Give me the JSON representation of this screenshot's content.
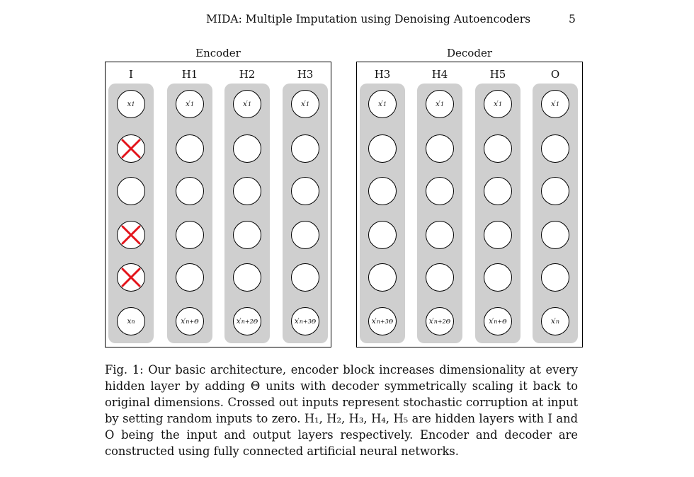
{
  "header": {
    "running_title": "MIDA: Multiple Imputation using Denoising Autoencoders",
    "page_number": "5"
  },
  "figure": {
    "blocks": [
      {
        "title": "Encoder",
        "columns": [
          {
            "label": "I",
            "nodes": [
              {
                "base": "x",
                "sub": "1",
                "prime": ""
              },
              {
                "crossed": true
              },
              {
                "base": ""
              },
              {
                "crossed": true
              },
              {
                "crossed": true
              },
              {
                "base": "x",
                "sub": "n",
                "prime": ""
              }
            ]
          },
          {
            "label": "H1",
            "nodes": [
              {
                "base": "x",
                "sub": "1",
                "prime": "′"
              },
              {
                "base": ""
              },
              {
                "base": ""
              },
              {
                "base": ""
              },
              {
                "base": ""
              },
              {
                "base": "x",
                "sub": "n+Θ",
                "prime": "′"
              }
            ]
          },
          {
            "label": "H2",
            "nodes": [
              {
                "base": "x",
                "sub": "1",
                "prime": "′"
              },
              {
                "base": ""
              },
              {
                "base": ""
              },
              {
                "base": ""
              },
              {
                "base": ""
              },
              {
                "base": "x",
                "sub": "n+2Θ",
                "prime": "′"
              }
            ]
          },
          {
            "label": "H3",
            "nodes": [
              {
                "base": "x",
                "sub": "1",
                "prime": "′"
              },
              {
                "base": ""
              },
              {
                "base": ""
              },
              {
                "base": ""
              },
              {
                "base": ""
              },
              {
                "base": "x",
                "sub": "n+3Θ",
                "prime": "′"
              }
            ]
          }
        ]
      },
      {
        "title": "Decoder",
        "columns": [
          {
            "label": "H3",
            "nodes": [
              {
                "base": "x",
                "sub": "1",
                "prime": "′"
              },
              {
                "base": ""
              },
              {
                "base": ""
              },
              {
                "base": ""
              },
              {
                "base": ""
              },
              {
                "base": "x",
                "sub": "n+3Θ",
                "prime": "′"
              }
            ]
          },
          {
            "label": "H4",
            "nodes": [
              {
                "base": "x",
                "sub": "1",
                "prime": "′"
              },
              {
                "base": ""
              },
              {
                "base": ""
              },
              {
                "base": ""
              },
              {
                "base": ""
              },
              {
                "base": "x",
                "sub": "n+2Θ",
                "prime": "′"
              }
            ]
          },
          {
            "label": "H5",
            "nodes": [
              {
                "base": "x",
                "sub": "1",
                "prime": "′"
              },
              {
                "base": ""
              },
              {
                "base": ""
              },
              {
                "base": ""
              },
              {
                "base": ""
              },
              {
                "base": "x",
                "sub": "n+Θ",
                "prime": "′"
              }
            ]
          },
          {
            "label": "O",
            "nodes": [
              {
                "base": "x",
                "sub": "1",
                "prime": "′"
              },
              {
                "base": ""
              },
              {
                "base": ""
              },
              {
                "base": ""
              },
              {
                "base": ""
              },
              {
                "base": "x",
                "sub": "n",
                "prime": "′"
              }
            ]
          }
        ]
      }
    ],
    "colors": {
      "column_fill": "#cfcfcf",
      "cross": "#e3141b"
    }
  },
  "caption": {
    "text": "Fig. 1: Our basic architecture, encoder block increases dimensionality at every hidden layer by adding Θ units with decoder symmetrically scaling it back to original dimensions. Crossed out inputs represent stochastic corruption at input by setting random inputs to zero. H₁, H₂, H₃, H₄, H₅ are hidden layers with I and O being the input and output layers respectively. Encoder and decoder are constructed using fully connected artificial neural networks."
  }
}
